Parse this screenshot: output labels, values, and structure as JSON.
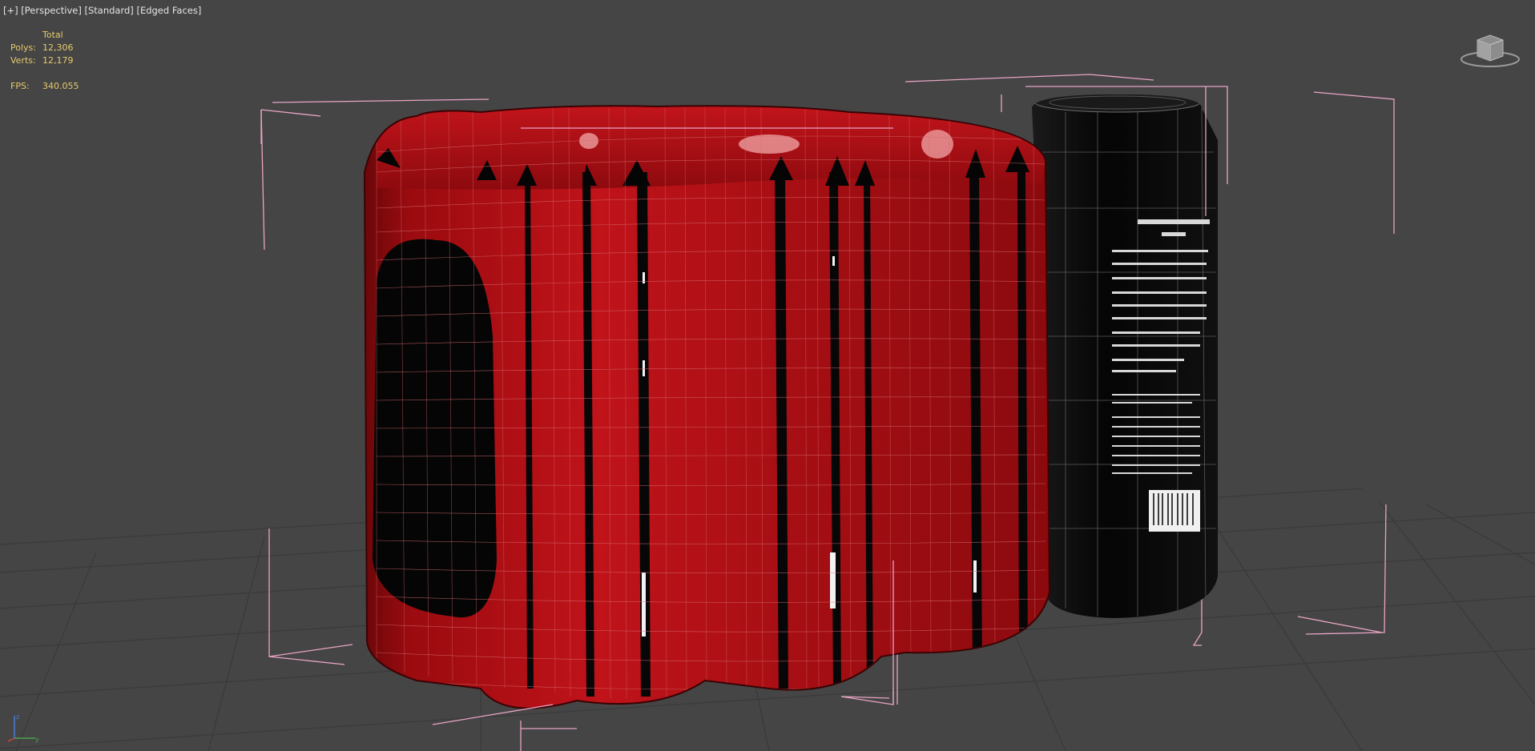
{
  "viewport": {
    "label_parts": [
      "[+]",
      "[Perspective]",
      "[Standard]",
      "[Edged Faces]"
    ]
  },
  "stats": {
    "header": "Total",
    "polys_label": "Polys:",
    "polys_value": "12,306",
    "verts_label": "Verts:",
    "verts_value": "12,179",
    "fps_label": "FPS:",
    "fps_value": "340.055"
  },
  "icons": {
    "viewcube": "viewcube-icon",
    "axis": "axis-tripod-icon"
  },
  "colors": {
    "background": "#454545",
    "grid": "#3a3a3a",
    "wrap_red": "#b40e12",
    "can_black": "#0c0c0c",
    "selection_bracket": "#e8a4c4",
    "stats_text": "#e7c96a",
    "label_text": "#e4e4e4"
  }
}
